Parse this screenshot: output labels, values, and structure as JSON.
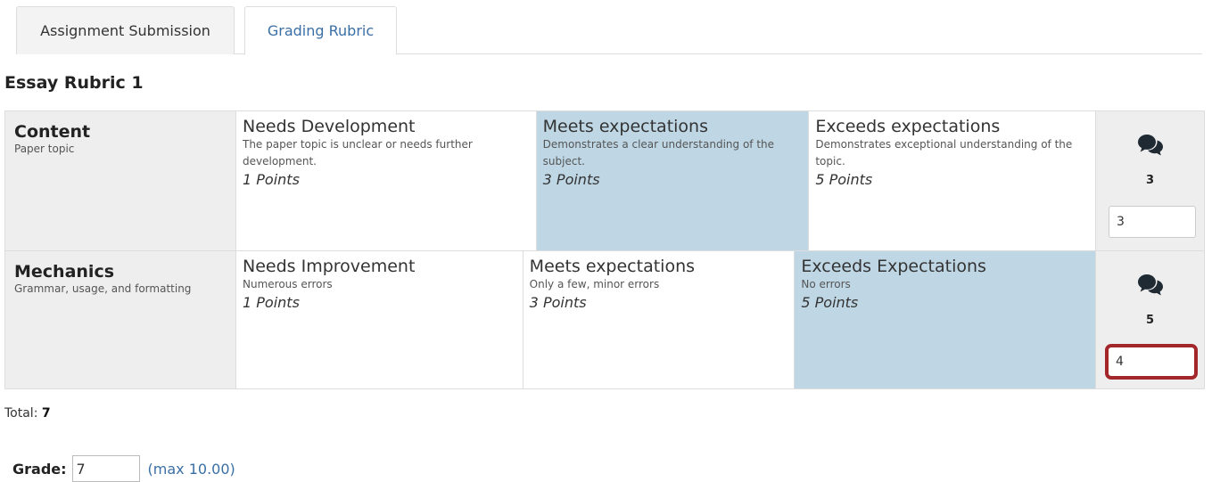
{
  "tabs": [
    {
      "label": "Assignment Submission",
      "active": false
    },
    {
      "label": "Grading Rubric",
      "active": true
    }
  ],
  "rubric_title": "Essay Rubric 1",
  "criteria": [
    {
      "title": "Content",
      "description": "Paper topic",
      "levels": [
        {
          "title": "Needs Development",
          "description": "The paper topic is unclear or needs further development.",
          "points": "1 Points",
          "selected": false
        },
        {
          "title": "Meets expectations",
          "description": "Demonstrates a clear understanding of the subject.",
          "points": "3 Points",
          "selected": true
        },
        {
          "title": "Exceeds expectations",
          "description": "Demonstrates exceptional understanding of the topic.",
          "points": "5 Points",
          "selected": false
        }
      ],
      "score": "3",
      "input_value": "3"
    },
    {
      "title": "Mechanics",
      "description": "Grammar, usage, and formatting",
      "levels": [
        {
          "title": "Needs Improvement",
          "description": "Numerous errors",
          "points": "1 Points",
          "selected": false
        },
        {
          "title": "Meets expectations",
          "description": "Only a few, minor errors",
          "points": "3 Points",
          "selected": false
        },
        {
          "title": "Exceeds Expectations",
          "description": "No errors",
          "points": "5 Points",
          "selected": true
        }
      ],
      "score": "5",
      "input_value": "4"
    }
  ],
  "total_label": "Total:",
  "total_value": "7",
  "grade_label": "Grade:",
  "grade_value": "7",
  "grade_max": "(max 10.00)",
  "colors": {
    "selected_level": "#bfd7e5",
    "highlight_border": "#a3262b",
    "link": "#3a6fa5"
  },
  "icons": {
    "comment": "comments-icon"
  }
}
